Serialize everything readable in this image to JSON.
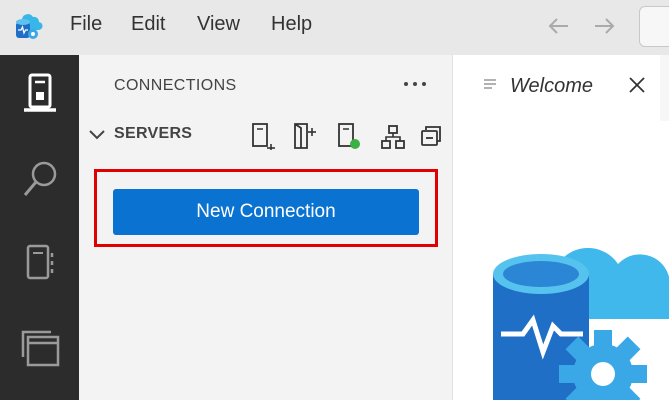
{
  "menu": {
    "file": "File",
    "edit": "Edit",
    "view": "View",
    "help": "Help"
  },
  "sidebar": {
    "title": "CONNECTIONS",
    "servers_label": "SERVERS",
    "new_connection_button": "New Connection"
  },
  "editor": {
    "tab_label": "Welcome"
  },
  "colors": {
    "primary_button": "#0a73d1",
    "highlight": "#e00000",
    "activity_bar": "#2c2c2c"
  },
  "icons": {
    "activity": [
      "connections-icon",
      "search-icon",
      "notebooks-icon",
      "extensions-icon"
    ],
    "servers_toolbar": [
      "new-connection-icon",
      "new-server-group-icon",
      "show-active-connections-icon",
      "server-tree-icon",
      "collapse-all-icon"
    ]
  }
}
